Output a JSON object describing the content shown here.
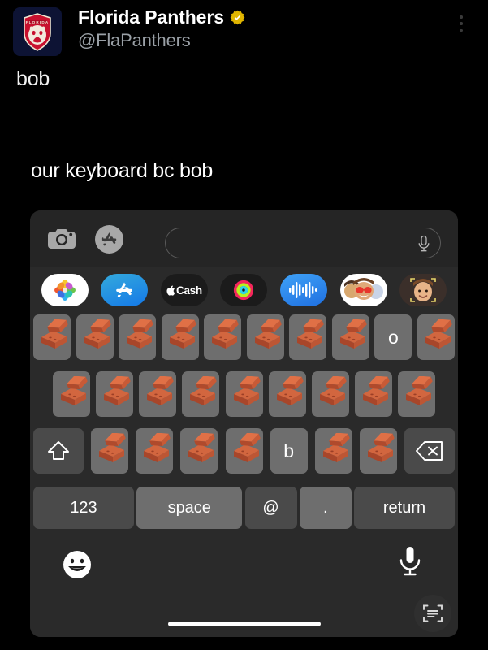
{
  "tweet": {
    "display_name": "Florida Panthers",
    "handle": "@FlaPanthers",
    "verified_badge_color": "#e0b500",
    "body_text": "bob",
    "more_menu_icon": "three-dots-vertical-icon",
    "avatar_icon": "florida-panthers-logo"
  },
  "caption": "our keyboard bc bob",
  "keyboard": {
    "toolbar": {
      "camera_icon": "camera-icon",
      "appstore_icon": "app-store-icon",
      "input_value": "",
      "input_placeholder": "",
      "mic_icon": "microphone-icon"
    },
    "app_row": [
      {
        "name": "Photos",
        "icon": "photos-icon"
      },
      {
        "name": "App Store",
        "icon": "app-store-icon"
      },
      {
        "name": "Apple Cash",
        "icon": "apple-cash-icon",
        "label": "Cash"
      },
      {
        "name": "Fitness",
        "icon": "activity-rings-icon"
      },
      {
        "name": "Digital Touch",
        "icon": "audio-waveform-icon"
      },
      {
        "name": "Memoji Stickers",
        "icon": "memoji-stickers-icon"
      },
      {
        "name": "Memoji",
        "icon": "memoji-icon"
      }
    ],
    "rows": [
      {
        "name": "row-1",
        "keys": [
          {
            "type": "brick",
            "label": ""
          },
          {
            "type": "brick",
            "label": ""
          },
          {
            "type": "brick",
            "label": ""
          },
          {
            "type": "brick",
            "label": ""
          },
          {
            "type": "brick",
            "label": ""
          },
          {
            "type": "brick",
            "label": ""
          },
          {
            "type": "brick",
            "label": ""
          },
          {
            "type": "brick",
            "label": ""
          },
          {
            "type": "letter",
            "label": "o"
          },
          {
            "type": "brick",
            "label": ""
          }
        ]
      },
      {
        "name": "row-2",
        "keys": [
          {
            "type": "brick",
            "label": ""
          },
          {
            "type": "brick",
            "label": ""
          },
          {
            "type": "brick",
            "label": ""
          },
          {
            "type": "brick",
            "label": ""
          },
          {
            "type": "brick",
            "label": ""
          },
          {
            "type": "brick",
            "label": ""
          },
          {
            "type": "brick",
            "label": ""
          },
          {
            "type": "brick",
            "label": ""
          },
          {
            "type": "brick",
            "label": ""
          }
        ]
      },
      {
        "name": "row-3",
        "keys": [
          {
            "type": "shift",
            "label": ""
          },
          {
            "type": "brick",
            "label": ""
          },
          {
            "type": "brick",
            "label": ""
          },
          {
            "type": "brick",
            "label": ""
          },
          {
            "type": "brick",
            "label": ""
          },
          {
            "type": "letter",
            "label": "b"
          },
          {
            "type": "brick",
            "label": ""
          },
          {
            "type": "brick",
            "label": ""
          },
          {
            "type": "backspace",
            "label": ""
          }
        ]
      },
      {
        "name": "row-4",
        "keys": [
          {
            "type": "func",
            "label": "123"
          },
          {
            "type": "space",
            "label": "space"
          },
          {
            "type": "func",
            "label": "@"
          },
          {
            "type": "period",
            "label": "."
          },
          {
            "type": "func",
            "label": "return"
          }
        ]
      }
    ],
    "bottom_bar": {
      "emoji_icon": "emoji-smiley-icon",
      "mic_icon": "microphone-icon",
      "home_indicator": "home-indicator",
      "scan_icon": "text-scan-icon"
    }
  },
  "colors": {
    "background": "#000000",
    "keyboard_bg": "#2a2a2a",
    "key_light": "#6e6e6e",
    "key_dark": "#4a4a4a",
    "brick": "#c0563a",
    "verified": "#e0b500"
  }
}
